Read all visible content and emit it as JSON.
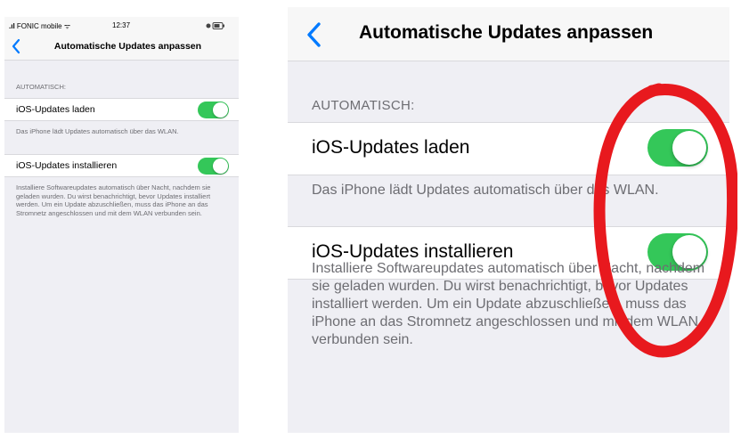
{
  "status_bar": {
    "carrier": "FONIC mobile",
    "time": "12:37"
  },
  "nav": {
    "title": "Automatische Updates anpassen"
  },
  "section": {
    "header": "AUTOMATISCH:"
  },
  "rows": [
    {
      "label": "iOS-Updates laden",
      "on": true,
      "footer": "Das iPhone lädt Updates automatisch über das WLAN."
    },
    {
      "label": "iOS-Updates installieren",
      "on": true,
      "footer": "Installiere Softwareupdates automatisch über Nacht, nachdem sie geladen wurden. Du wirst benachrichtigt, bevor Updates installiert werden. Um ein Update abzuschließen, muss das iPhone an das Stromnetz angeschlossen und mit dem WLAN verbunden sein."
    }
  ],
  "colors": {
    "toggle_on": "#34c759",
    "accent": "#007aff",
    "annotation": "#e8191e"
  },
  "icons": [
    "chevron-left-icon",
    "signal-icon",
    "wifi-icon",
    "battery-icon"
  ]
}
